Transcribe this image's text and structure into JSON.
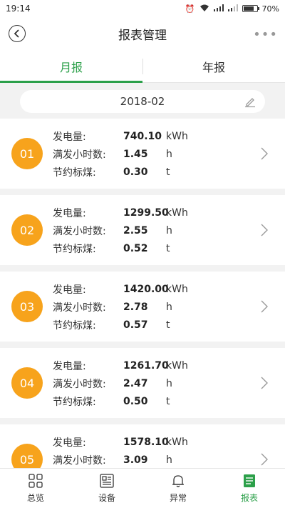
{
  "status_bar": {
    "time": "19:14",
    "battery": "70%"
  },
  "header": {
    "title": "报表管理"
  },
  "tabs": [
    {
      "label": "月报",
      "active": true
    },
    {
      "label": "年报",
      "active": false
    }
  ],
  "date_selector": {
    "value": "2018-02"
  },
  "labels": {
    "generation": "发电量:",
    "full_hours": "满发小时数:",
    "coal_saving": "节约标煤:"
  },
  "units": {
    "generation": "kWh",
    "full_hours": "h",
    "coal_saving": "t"
  },
  "records": [
    {
      "month": "01",
      "generation": "740.10",
      "full_hours": "1.45",
      "coal_saving": "0.30"
    },
    {
      "month": "02",
      "generation": "1299.50",
      "full_hours": "2.55",
      "coal_saving": "0.52"
    },
    {
      "month": "03",
      "generation": "1420.00",
      "full_hours": "2.78",
      "coal_saving": "0.57"
    },
    {
      "month": "04",
      "generation": "1261.70",
      "full_hours": "2.47",
      "coal_saving": "0.50"
    },
    {
      "month": "05",
      "generation": "1578.10",
      "full_hours": "3.09",
      "coal_saving": ""
    }
  ],
  "bottom_nav": [
    {
      "label": "总览",
      "icon": "grid-icon",
      "active": false
    },
    {
      "label": "设备",
      "icon": "device-icon",
      "active": false
    },
    {
      "label": "异常",
      "icon": "bell-icon",
      "active": false
    },
    {
      "label": "报表",
      "icon": "report-icon",
      "active": true
    }
  ],
  "colors": {
    "accent": "#2ca04a",
    "badge": "#f7a31c"
  }
}
